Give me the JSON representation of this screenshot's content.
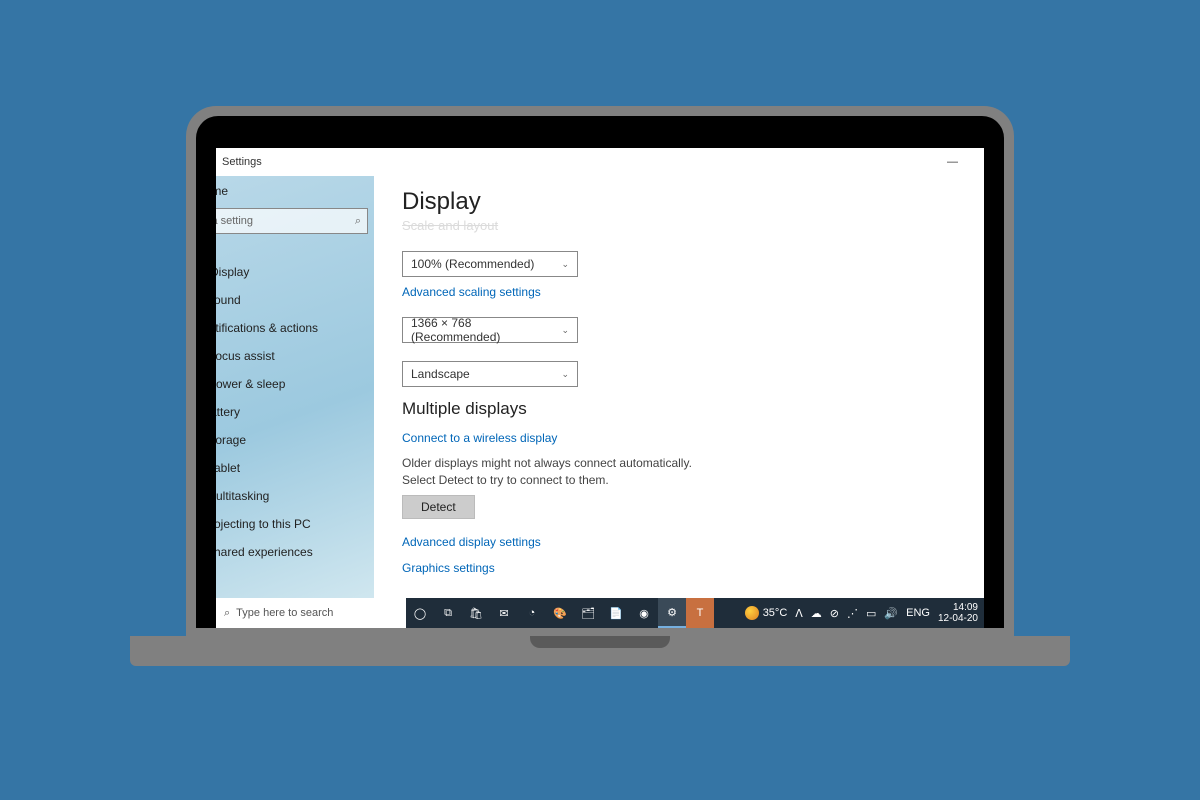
{
  "window": {
    "title": "Settings",
    "minimize": "—"
  },
  "sidebar": {
    "home": "Home",
    "search_placeholder": "Find a setting",
    "items": [
      "Display",
      "Sound",
      "Notifications & actions",
      "Focus assist",
      "Power & sleep",
      "Battery",
      "Storage",
      "Tablet",
      "Multitasking",
      "Projecting to this PC",
      "Shared experiences"
    ]
  },
  "main": {
    "title": "Display",
    "section_scale": "Scale and layout",
    "scale_value": "100% (Recommended)",
    "adv_scaling": "Advanced scaling settings",
    "resolution_value": "1366 × 768 (Recommended)",
    "orientation_value": "Landscape",
    "multi_title": "Multiple displays",
    "connect_wireless": "Connect to a wireless display",
    "detect_text": "Older displays might not always connect automatically. Select Detect to try to connect to them.",
    "detect_btn": "Detect",
    "adv_display": "Advanced display settings",
    "graphics": "Graphics settings"
  },
  "taskbar": {
    "search": "Type here to search",
    "weather_temp": "35°C",
    "lang": "ENG",
    "time": "14:09",
    "date": "12-04-20"
  }
}
